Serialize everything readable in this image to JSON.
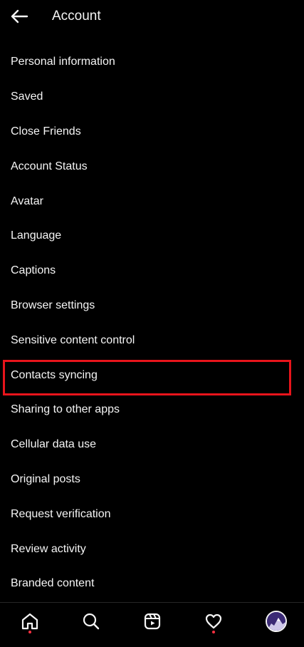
{
  "header": {
    "title": "Account",
    "back_icon": "arrow-left-icon"
  },
  "menu": {
    "items": [
      {
        "label": "Personal information"
      },
      {
        "label": "Saved"
      },
      {
        "label": "Close Friends"
      },
      {
        "label": "Account Status"
      },
      {
        "label": "Avatar"
      },
      {
        "label": "Language"
      },
      {
        "label": "Captions"
      },
      {
        "label": "Browser settings"
      },
      {
        "label": "Sensitive content control"
      },
      {
        "label": "Contacts syncing",
        "highlighted": true
      },
      {
        "label": "Sharing to other apps"
      },
      {
        "label": "Cellular data use"
      },
      {
        "label": "Original posts"
      },
      {
        "label": "Request verification"
      },
      {
        "label": "Review activity"
      },
      {
        "label": "Branded content"
      }
    ]
  },
  "bottom_nav": {
    "items": [
      {
        "icon": "home-icon",
        "notification_dot": true
      },
      {
        "icon": "search-icon",
        "notification_dot": false
      },
      {
        "icon": "reels-icon",
        "notification_dot": false
      },
      {
        "icon": "heart-icon",
        "notification_dot": true
      },
      {
        "icon": "profile-avatar",
        "notification_dot": false
      }
    ]
  },
  "colors": {
    "background": "#000000",
    "text": "#f5f5f5",
    "highlight_border": "#e8141b",
    "notification_dot": "#ff3040"
  }
}
